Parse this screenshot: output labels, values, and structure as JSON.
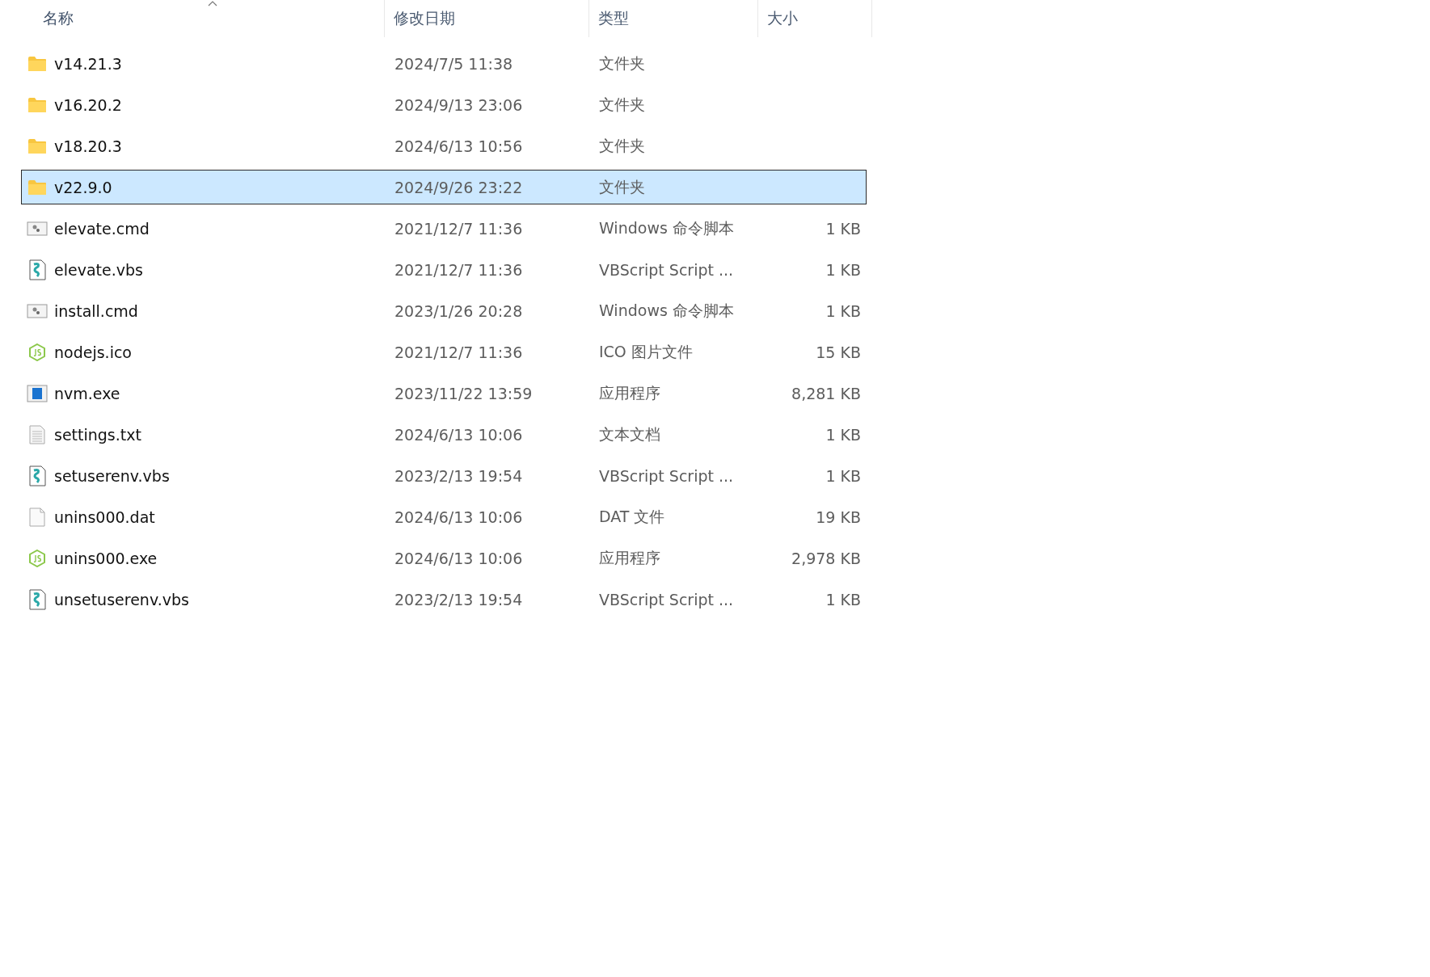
{
  "columns": [
    {
      "label": "名称",
      "sorted": true
    },
    {
      "label": "修改日期",
      "sorted": false
    },
    {
      "label": "类型",
      "sorted": false
    },
    {
      "label": "大小",
      "sorted": false
    }
  ],
  "rows": [
    {
      "kind": "folder",
      "name": "v14.21.3",
      "modified": "2024/7/5 11:38",
      "type": "文件夹",
      "selected": false
    },
    {
      "kind": "folder",
      "name": "v16.20.2",
      "modified": "2024/9/13 23:06",
      "type": "文件夹",
      "selected": false
    },
    {
      "kind": "folder",
      "name": "v18.20.3",
      "modified": "2024/6/13 10:56",
      "type": "文件夹",
      "selected": false
    },
    {
      "kind": "folder",
      "name": "v22.9.0",
      "modified": "2024/9/26 23:22",
      "type": "文件夹",
      "selected": true
    },
    {
      "kind": "cmd",
      "name": "elevate.cmd",
      "modified": "2021/12/7 11:36",
      "type": "Windows 命令脚本",
      "size": "1 KB",
      "selected": false
    },
    {
      "kind": "vbs",
      "name": "elevate.vbs",
      "modified": "2021/12/7 11:36",
      "type": "VBScript Script ...",
      "size": "1 KB",
      "selected": false
    },
    {
      "kind": "cmd",
      "name": "install.cmd",
      "modified": "2023/1/26 20:28",
      "type": "Windows 命令脚本",
      "size": "1 KB",
      "selected": false
    },
    {
      "kind": "node",
      "name": "nodejs.ico",
      "modified": "2021/12/7 11:36",
      "type": "ICO 图片文件",
      "size": "15 KB",
      "selected": false
    },
    {
      "kind": "exe",
      "name": "nvm.exe",
      "modified": "2023/11/22 13:59",
      "type": "应用程序",
      "size": "8,281 KB",
      "selected": false
    },
    {
      "kind": "txt",
      "name": "settings.txt",
      "modified": "2024/6/13 10:06",
      "type": "文本文档",
      "size": "1 KB",
      "selected": false
    },
    {
      "kind": "vbs",
      "name": "setuserenv.vbs",
      "modified": "2023/2/13 19:54",
      "type": "VBScript Script ...",
      "size": "1 KB",
      "selected": false
    },
    {
      "kind": "blank",
      "name": "unins000.dat",
      "modified": "2024/6/13 10:06",
      "type": "DAT 文件",
      "size": "19 KB",
      "selected": false
    },
    {
      "kind": "node",
      "name": "unins000.exe",
      "modified": "2024/6/13 10:06",
      "type": "应用程序",
      "size": "2,978 KB",
      "selected": false
    },
    {
      "kind": "vbs",
      "name": "unsetuserenv.vbs",
      "modified": "2023/2/13 19:54",
      "type": "VBScript Script ...",
      "size": "1 KB",
      "selected": false
    }
  ]
}
